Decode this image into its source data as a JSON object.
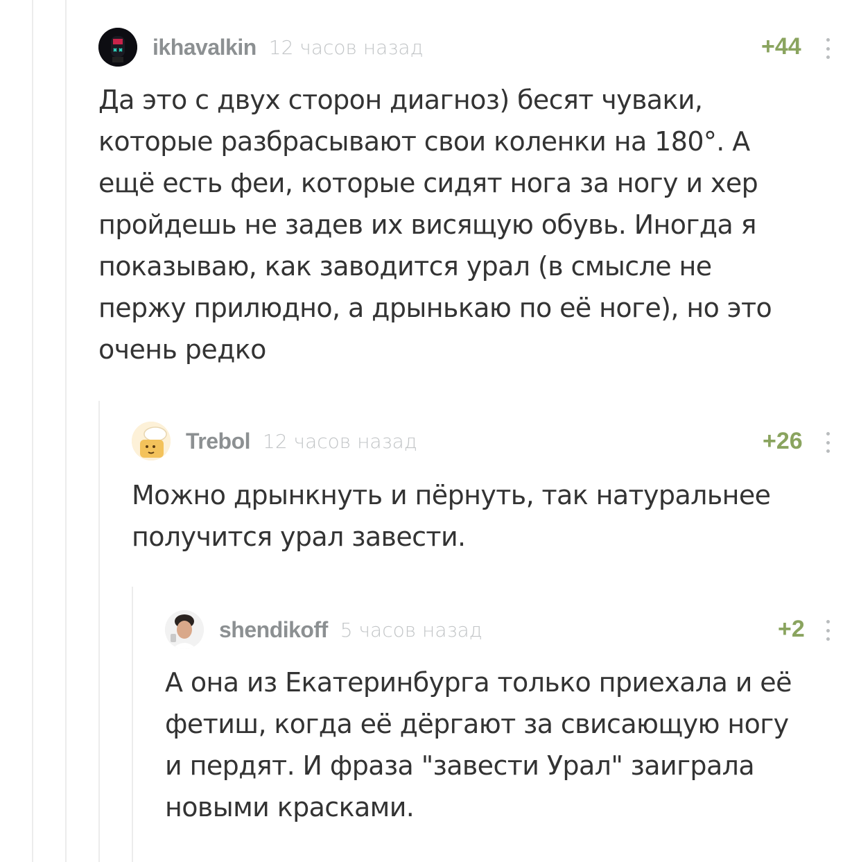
{
  "comments": [
    {
      "username": "ikhavalkin",
      "time": "12 часов назад",
      "rating": "+44",
      "avatar_icon": "robot-mask-avatar",
      "lines": [
        "Да это с двух сторон диагноз) бесят чуваки,",
        "которые разбрасывают свои коленки на 180°. А",
        "ещё есть феи, которые сидят нога за ногу и хер",
        "пройдешь не задев их висящую обувь. Иногда я",
        "показываю, как заводится урал (в смысле не",
        "пержу прилюдно, а дрынькаю по её ноге), но это",
        "очень редко"
      ]
    },
    {
      "username": "Trebol",
      "time": "12 часов назад",
      "rating": "+26",
      "avatar_icon": "cartoon-avatar",
      "lines": [
        "Можно дрынкнуть и пёрнуть, так натуральнее",
        "получится урал завести."
      ]
    },
    {
      "username": "shendikoff",
      "time": "5 часов назад",
      "rating": "+2",
      "avatar_icon": "person-photo-avatar",
      "lines": [
        "А она из Екатеринбурга только приехала и её",
        "фетиш, когда её дёргают за свисающую ногу",
        "и пердят. И фраза \"завести Урал\" заиграла",
        "новыми красками."
      ]
    }
  ],
  "colors": {
    "rating_green": "#8aa45f",
    "username_gray": "#8c9092",
    "time_gray": "#c2c5c7",
    "thread_line": "#ececec",
    "text": "#333333"
  }
}
